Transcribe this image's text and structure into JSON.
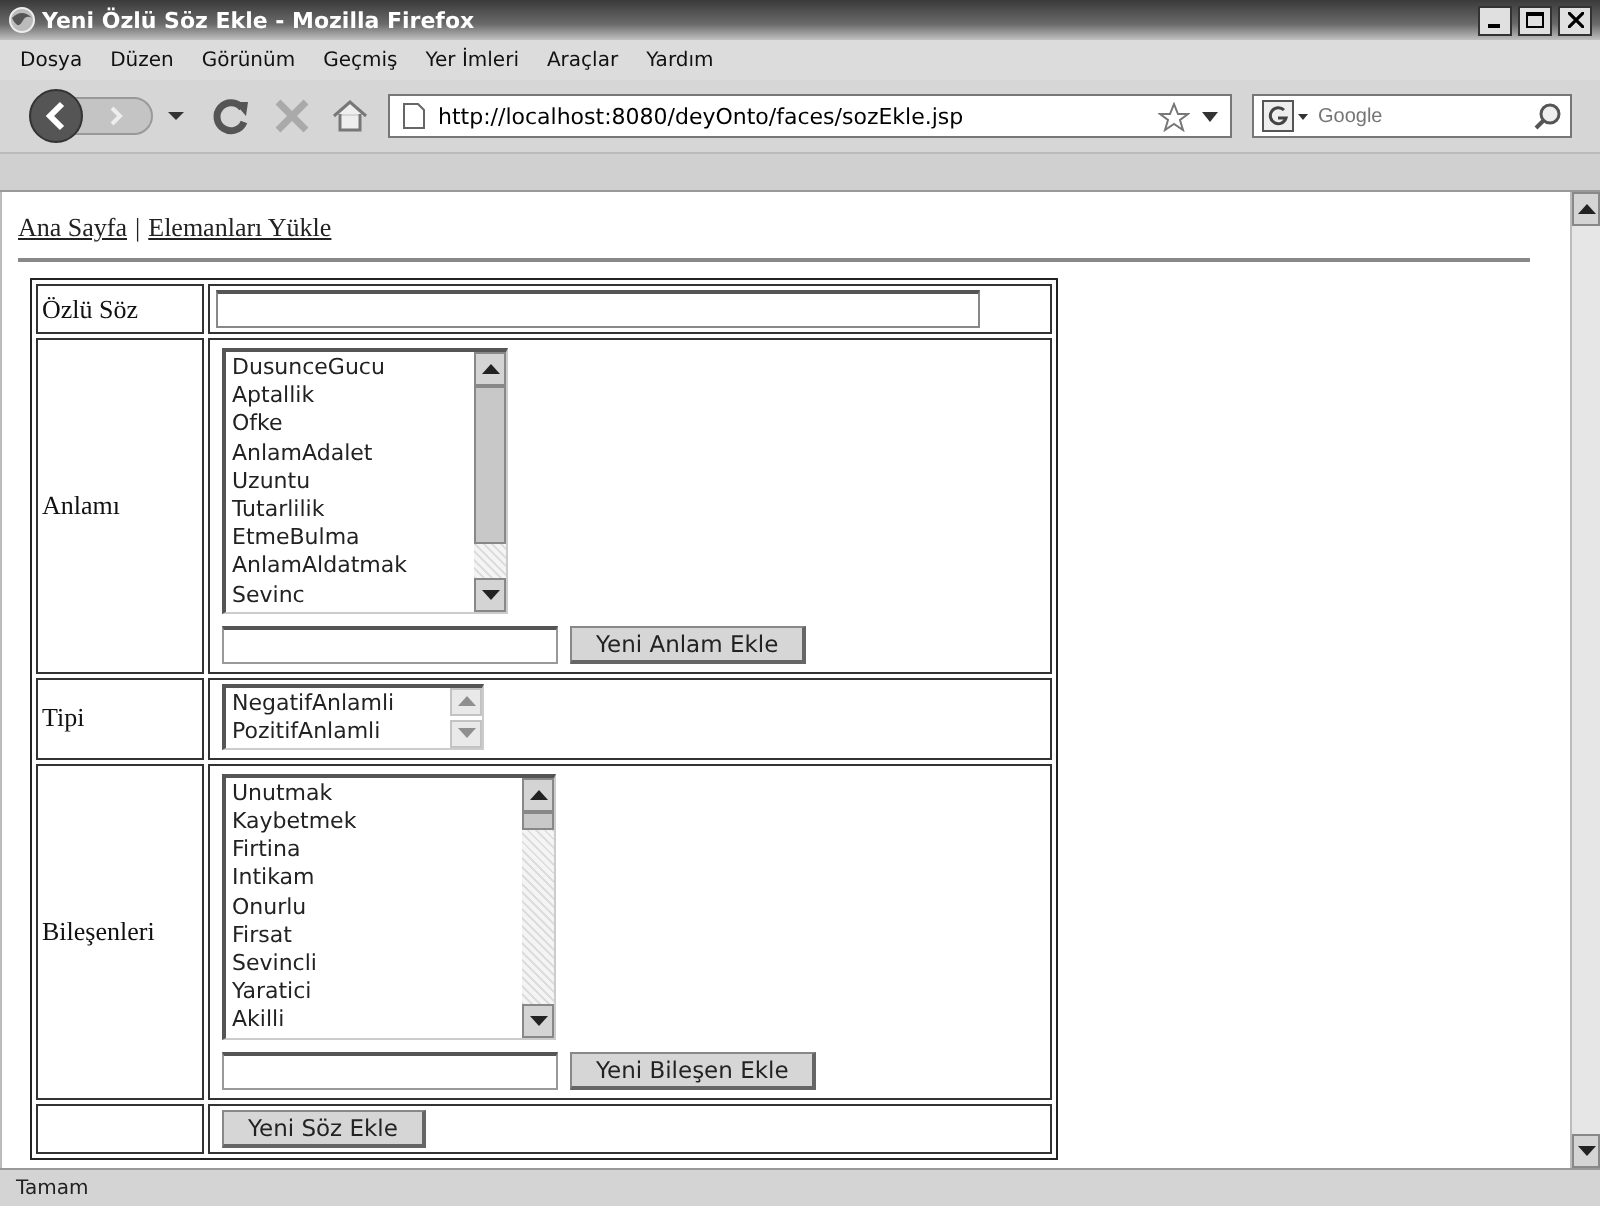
{
  "window": {
    "title": "Yeni Özlü Söz Ekle - Mozilla Firefox"
  },
  "menu": [
    "Dosya",
    "Düzen",
    "Görünüm",
    "Geçmiş",
    "Yer İmleri",
    "Araçlar",
    "Yardım"
  ],
  "address": {
    "value": "http://localhost:8080/deyOnto/faces/sozEkle.jsp"
  },
  "search": {
    "placeholder": "Google"
  },
  "nav_links": [
    "Ana Sayfa",
    "Elemanları Yükle"
  ],
  "nav_separator": "|",
  "form": {
    "rows": [
      {
        "kind": "text",
        "label": "Özlü Söz"
      },
      {
        "kind": "list_add",
        "label": "Anlamı",
        "options": [
          "DusunceGucu",
          "Aptallik",
          "Ofke",
          "AnlamAdalet",
          "Uzuntu",
          "Tutarlilik",
          "EtmeBulma",
          "AnlamAldatmak",
          "Sevinc"
        ],
        "button": "Yeni Anlam Ekle"
      },
      {
        "kind": "list",
        "label": "Tipi",
        "options": [
          "NegatifAnlamli",
          "PozitifAnlamli"
        ]
      },
      {
        "kind": "list_add",
        "label": "Bileşenleri",
        "options": [
          "Unutmak",
          "Kaybetmek",
          "Firtina",
          "Intikam",
          "Onurlu",
          "Firsat",
          "Sevincli",
          "Yaratici",
          "Akilli"
        ],
        "button": "Yeni Bileşen Ekle"
      },
      {
        "kind": "submit",
        "button": "Yeni Söz Ekle"
      }
    ]
  },
  "status_bar": "Tamam"
}
